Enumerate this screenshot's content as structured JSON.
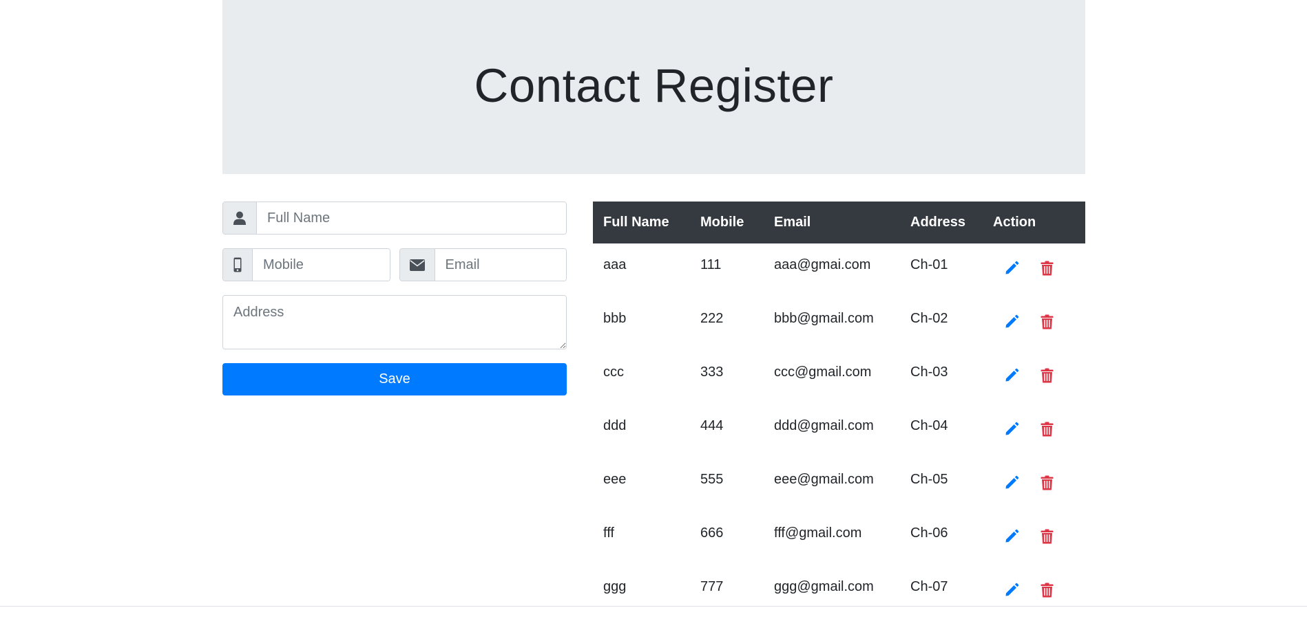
{
  "header": {
    "title": "Contact Register"
  },
  "form": {
    "fullname_placeholder": "Full Name",
    "mobile_placeholder": "Mobile",
    "email_placeholder": "Email",
    "address_placeholder": "Address",
    "save_label": "Save",
    "icons": {
      "fullname": "user-icon",
      "mobile": "mobile-phone-icon",
      "email": "envelope-icon"
    }
  },
  "table": {
    "columns": [
      "Full Name",
      "Mobile",
      "Email",
      "Address",
      "Action"
    ],
    "rows": [
      {
        "name": "aaa",
        "mobile": "111",
        "email": "aaa@gmai.com",
        "address": "Ch-01"
      },
      {
        "name": "bbb",
        "mobile": "222",
        "email": "bbb@gmail.com",
        "address": "Ch-02"
      },
      {
        "name": "ccc",
        "mobile": "333",
        "email": "ccc@gmail.com",
        "address": "Ch-03"
      },
      {
        "name": "ddd",
        "mobile": "444",
        "email": "ddd@gmail.com",
        "address": "Ch-04"
      },
      {
        "name": "eee",
        "mobile": "555",
        "email": "eee@gmail.com",
        "address": "Ch-05"
      },
      {
        "name": "fff",
        "mobile": "666",
        "email": "fff@gmail.com",
        "address": "Ch-06"
      },
      {
        "name": "ggg",
        "mobile": "777",
        "email": "ggg@gmail.com",
        "address": "Ch-07"
      }
    ],
    "action_icons": {
      "edit": "pencil-icon",
      "delete": "trash-icon"
    }
  },
  "colors": {
    "jumbotron_bg": "#e9ecef",
    "primary": "#007bff",
    "danger": "#dc3545",
    "table_header_bg": "#343a40"
  }
}
